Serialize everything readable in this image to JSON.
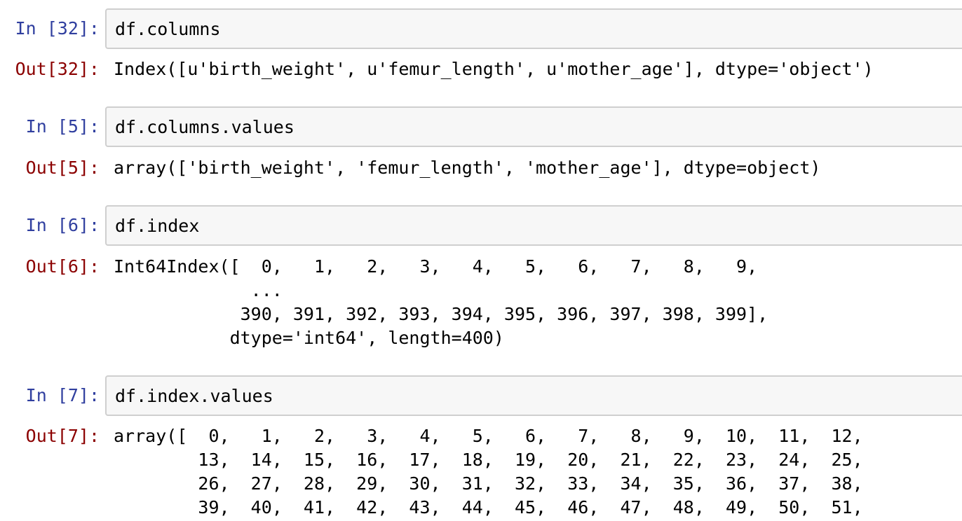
{
  "cells": [
    {
      "in_prompt": "In [32]:",
      "code": "df.columns",
      "out_prompt": "Out[32]:",
      "output": "Index([u'birth_weight', u'femur_length', u'mother_age'], dtype='object')"
    },
    {
      "in_prompt": "In [5]:",
      "code": "df.columns.values",
      "out_prompt": "Out[5]:",
      "output": "array(['birth_weight', 'femur_length', 'mother_age'], dtype=object)"
    },
    {
      "in_prompt": "In [6]:",
      "code": "df.index",
      "out_prompt": "Out[6]:",
      "output": "Int64Index([  0,   1,   2,   3,   4,   5,   6,   7,   8,   9,\n             ...\n            390, 391, 392, 393, 394, 395, 396, 397, 398, 399],\n           dtype='int64', length=400)"
    },
    {
      "in_prompt": "In [7]:",
      "code": "df.index.values",
      "out_prompt": "Out[7]:",
      "output": "array([  0,   1,   2,   3,   4,   5,   6,   7,   8,   9,  10,  11,  12,\n        13,  14,  15,  16,  17,  18,  19,  20,  21,  22,  23,  24,  25,\n        26,  27,  28,  29,  30,  31,  32,  33,  34,  35,  36,  37,  38,\n        39,  40,  41,  42,  43,  44,  45,  46,  47,  48,  49,  50,  51,"
    }
  ]
}
